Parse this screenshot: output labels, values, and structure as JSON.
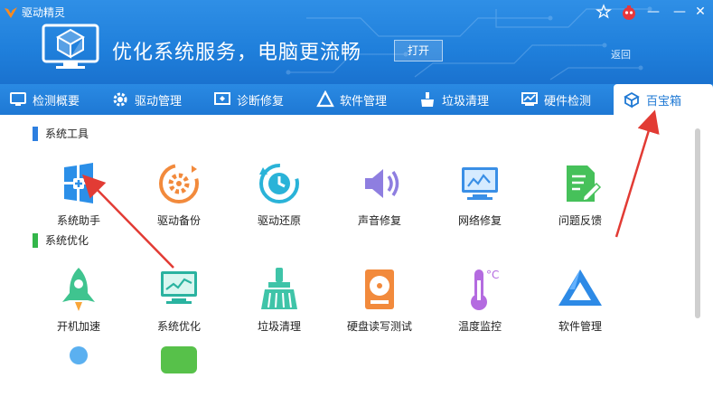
{
  "window": {
    "title": "驱动精灵",
    "controls": [
      "☆",
      "●",
      "—",
      "✕"
    ]
  },
  "header": {
    "title": "优化系统服务，电脑更流畅",
    "open_label": "打开",
    "back_label": "返回"
  },
  "tabs": [
    {
      "label": "检测概要",
      "icon": "monitor-icon"
    },
    {
      "label": "驱动管理",
      "icon": "gear-icon"
    },
    {
      "label": "诊断修复",
      "icon": "repair-icon"
    },
    {
      "label": "软件管理",
      "icon": "software-icon"
    },
    {
      "label": "垃圾清理",
      "icon": "broom-icon"
    },
    {
      "label": "硬件检测",
      "icon": "hardware-icon"
    },
    {
      "label": "百宝箱",
      "icon": "box-icon",
      "active": true
    }
  ],
  "sections": [
    {
      "title": "系统工具",
      "color": "#2d7fe0",
      "items": [
        {
          "label": "系统助手",
          "icon": "system-helper-icon"
        },
        {
          "label": "驱动备份",
          "icon": "driver-backup-icon"
        },
        {
          "label": "驱动还原",
          "icon": "driver-restore-icon"
        },
        {
          "label": "声音修复",
          "icon": "sound-repair-icon"
        },
        {
          "label": "网络修复",
          "icon": "network-repair-icon"
        },
        {
          "label": "问题反馈",
          "icon": "feedback-icon"
        }
      ]
    },
    {
      "title": "系统优化",
      "color": "#33b64a",
      "items": [
        {
          "label": "开机加速",
          "icon": "boot-speed-icon"
        },
        {
          "label": "系统优化",
          "icon": "system-optimize-icon"
        },
        {
          "label": "垃圾清理",
          "icon": "junk-clean-icon"
        },
        {
          "label": "硬盘读写测试",
          "icon": "disk-test-icon"
        },
        {
          "label": "温度监控",
          "icon": "temperature-icon"
        },
        {
          "label": "软件管理",
          "icon": "software-manage-icon"
        }
      ]
    }
  ]
}
